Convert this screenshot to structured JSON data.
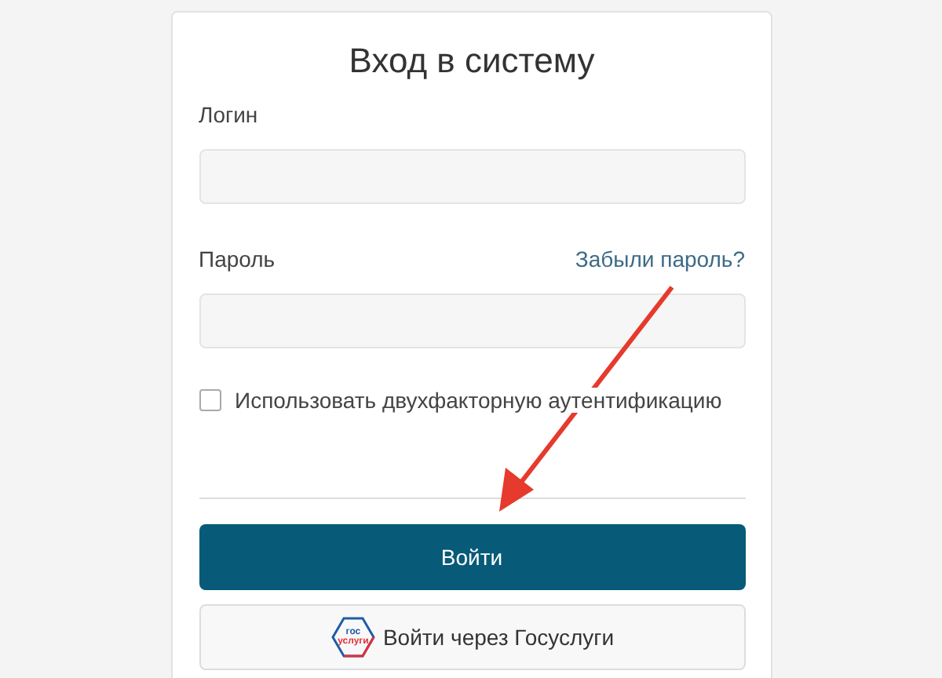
{
  "title": "Вход в систему",
  "login": {
    "label": "Логин"
  },
  "password": {
    "label": "Пароль",
    "forgot_link": "Забыли пароль?"
  },
  "two_factor": {
    "label": "Использовать двухфакторную аутентификацию",
    "checked": false
  },
  "submit_button": "Войти",
  "gosuslugi_button": {
    "label": "Войти через Госуслуги",
    "logo_lines": [
      "гос",
      "услуги"
    ]
  }
}
